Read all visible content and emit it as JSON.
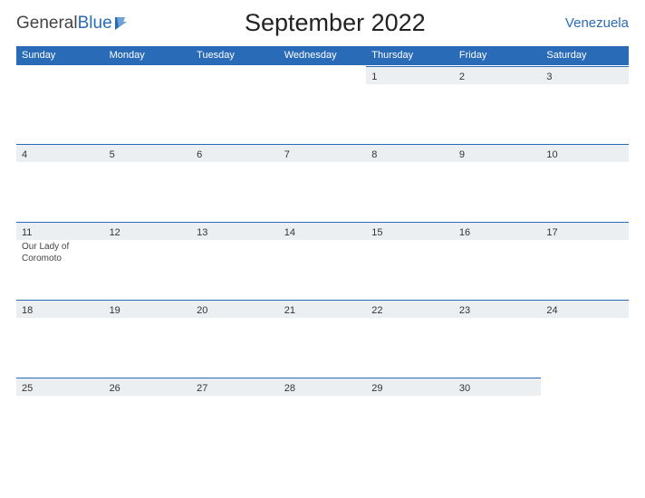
{
  "logo": {
    "text1": "General",
    "text2": "Blue"
  },
  "title": "September 2022",
  "country": "Venezuela",
  "days": [
    "Sunday",
    "Monday",
    "Tuesday",
    "Wednesday",
    "Thursday",
    "Friday",
    "Saturday"
  ],
  "weeks": [
    [
      {
        "n": "",
        "blank": true
      },
      {
        "n": "",
        "blank": true
      },
      {
        "n": "",
        "blank": true
      },
      {
        "n": "",
        "blank": true
      },
      {
        "n": "1"
      },
      {
        "n": "2"
      },
      {
        "n": "3"
      }
    ],
    [
      {
        "n": "4"
      },
      {
        "n": "5"
      },
      {
        "n": "6"
      },
      {
        "n": "7"
      },
      {
        "n": "8"
      },
      {
        "n": "9"
      },
      {
        "n": "10"
      }
    ],
    [
      {
        "n": "11",
        "event": "Our Lady of Coromoto"
      },
      {
        "n": "12"
      },
      {
        "n": "13"
      },
      {
        "n": "14"
      },
      {
        "n": "15"
      },
      {
        "n": "16"
      },
      {
        "n": "17"
      }
    ],
    [
      {
        "n": "18"
      },
      {
        "n": "19"
      },
      {
        "n": "20"
      },
      {
        "n": "21"
      },
      {
        "n": "22"
      },
      {
        "n": "23"
      },
      {
        "n": "24"
      }
    ],
    [
      {
        "n": "25"
      },
      {
        "n": "26"
      },
      {
        "n": "27"
      },
      {
        "n": "28"
      },
      {
        "n": "29"
      },
      {
        "n": "30"
      },
      {
        "n": "",
        "blank": true
      }
    ]
  ]
}
